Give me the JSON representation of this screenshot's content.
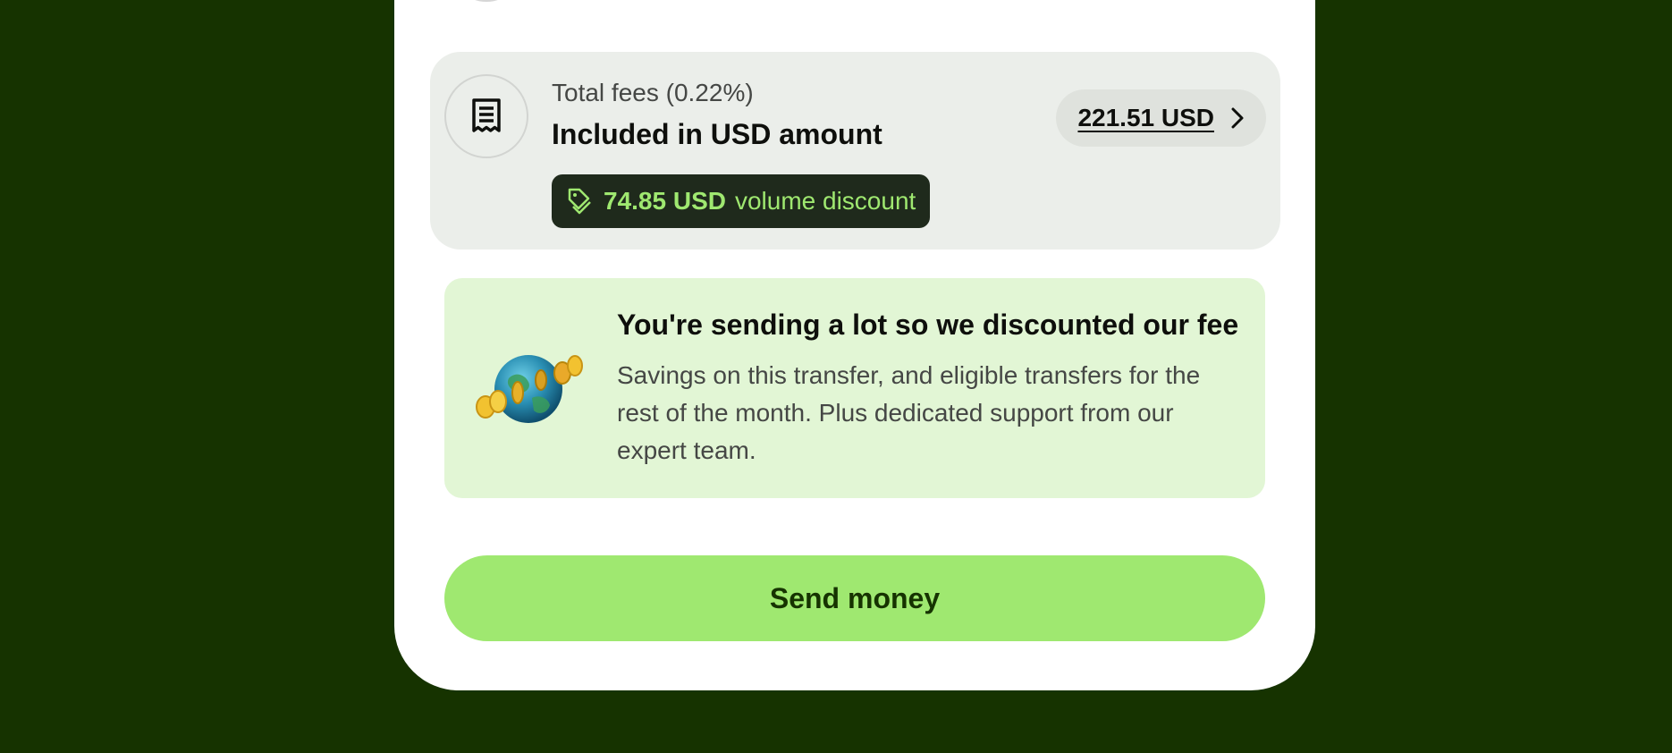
{
  "fees": {
    "label": "Total fees (0.22%)",
    "title": "Included in USD amount",
    "amount": "221.51 USD",
    "discount_amount": "74.85 USD",
    "discount_suffix": "volume discount"
  },
  "promo": {
    "title": "You're sending a lot so we discounted our fee",
    "body": "Savings on this transfer, and eligible transfers for the rest of the month. Plus dedicated support from our expert team."
  },
  "actions": {
    "send_label": "Send money"
  },
  "icons": {
    "fees": "receipt-icon",
    "discount": "tag-icon",
    "pill": "chevron-right-icon",
    "promo": "globe-coins-illustration"
  },
  "colors": {
    "background": "#163300",
    "accent": "#9fe870",
    "promo_bg": "#e2f6d5",
    "panel_bg": "#ebeeea",
    "chip_bg": "#1f2a1c"
  }
}
